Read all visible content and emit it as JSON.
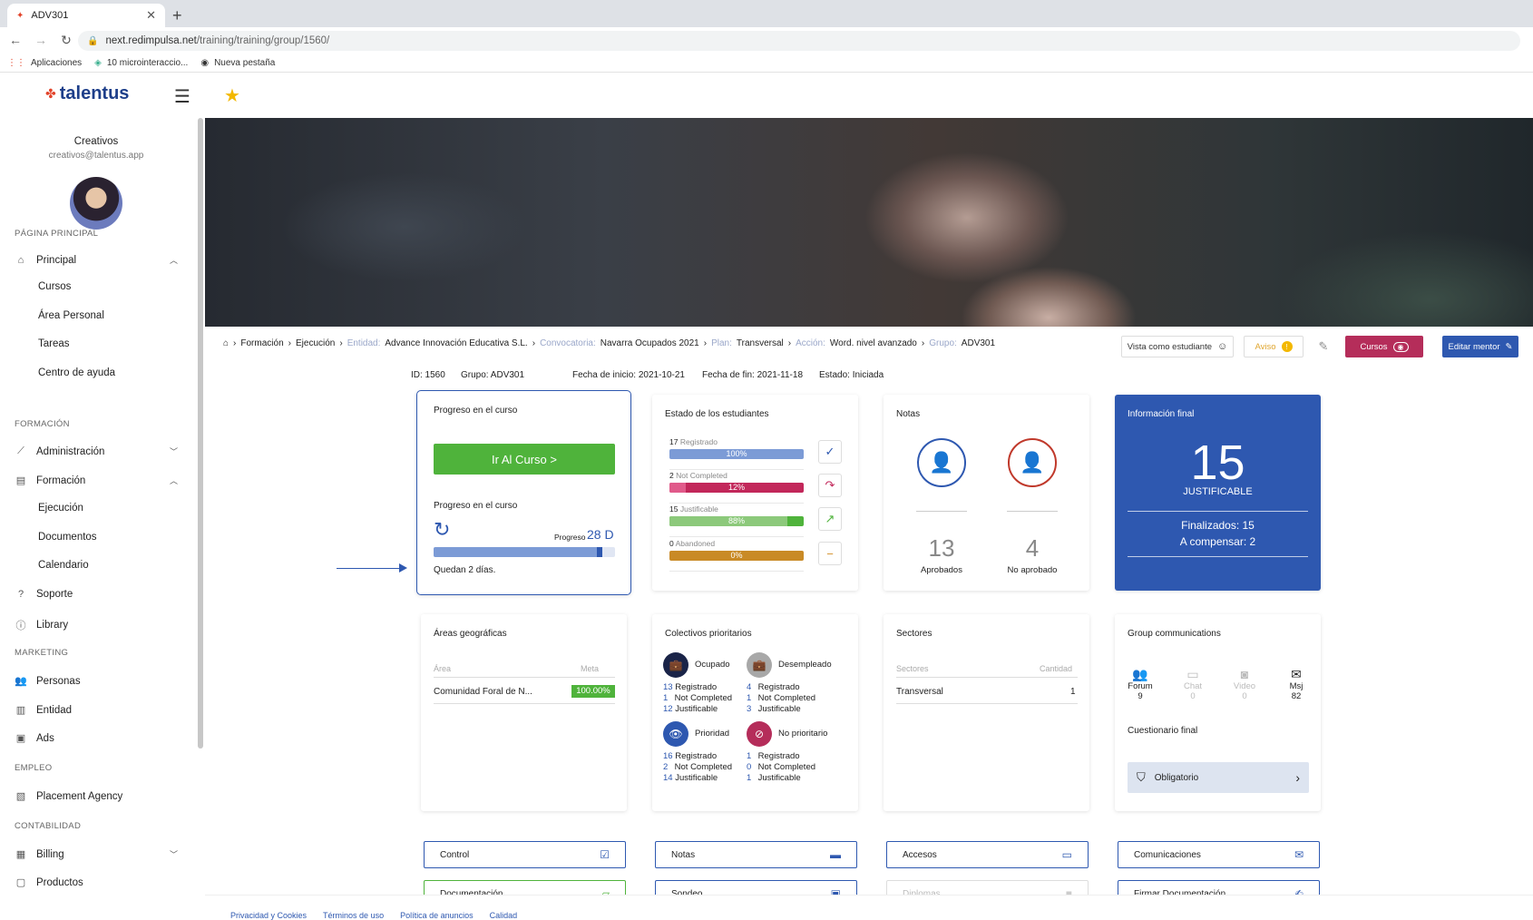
{
  "browser": {
    "tab_title": "ADV301",
    "url_host": "next.redimpulsa.net",
    "url_path": "/training/training/group/1560/",
    "bookmarks": [
      "Aplicaciones",
      "10 microinteraccio...",
      "Nueva pestaña"
    ]
  },
  "sidebar": {
    "logo": "talentus",
    "user_name": "Creativos",
    "user_email": "creativos@talentus.app",
    "sections": {
      "main": "PÁGINA PRINCIPAL",
      "training": "FORMACIÓN",
      "marketing": "MARKETING",
      "employment": "EMPLEO",
      "accounting": "CONTABILIDAD"
    },
    "items": {
      "principal": "Principal",
      "cursos": "Cursos",
      "area_personal": "Área Personal",
      "tareas": "Tareas",
      "centro_ayuda": "Centro de ayuda",
      "administracion": "Administración",
      "formacion": "Formación",
      "ejecucion": "Ejecución",
      "documentos": "Documentos",
      "calendario": "Calendario",
      "soporte": "Soporte",
      "library": "Library",
      "personas": "Personas",
      "entidad": "Entidad",
      "ads": "Ads",
      "placement": "Placement Agency",
      "billing": "Billing",
      "productos": "Productos"
    }
  },
  "breadcrumb": {
    "formacion": "Formación",
    "ejecucion": "Ejecución",
    "entidad_lbl": "Entidad:",
    "entidad": "Advance Innovación Educativa S.L.",
    "convocatoria_lbl": "Convocatoria:",
    "convocatoria": "Navarra Ocupados 2021",
    "plan_lbl": "Plan:",
    "plan": "Transversal",
    "accion_lbl": "Acción:",
    "accion": "Word. nivel avanzado",
    "grupo_lbl": "Grupo:",
    "grupo": "ADV301"
  },
  "actions": {
    "vista": "Vista como estudiante",
    "aviso": "Aviso",
    "cursos": "Cursos",
    "mentor": "Editar mentor"
  },
  "info": {
    "id": "ID: 1560",
    "grupo": "Grupo: ADV301",
    "inicio": "Fecha de inicio: 2021-10-21",
    "fin": "Fecha de fin: 2021-11-18",
    "estado": "Estado: Iniciada"
  },
  "progreso": {
    "title": "Progreso en el curso",
    "button": "Ir Al Curso >",
    "subtitle": "Progreso en el curso",
    "days_label": "Progreso",
    "days": "28 D",
    "remaining": "Quedan 2 días.",
    "fraction": 0.93
  },
  "estado": {
    "title": "Estado de los estudiantes",
    "rows": [
      {
        "count": "17",
        "label": "Registrado",
        "pct": "100%",
        "value": 100,
        "color": "#7c9bd6",
        "track": "#c9d5ef",
        "icon": "✓",
        "icon_color": "#2e58b0"
      },
      {
        "count": "2",
        "label": "Not Completed",
        "pct": "12%",
        "value": 12,
        "color": "#e05a8a",
        "track": "#c2275a",
        "icon": "↷",
        "icon_color": "#c2275a"
      },
      {
        "count": "15",
        "label": "Justificable",
        "pct": "88%",
        "value": 88,
        "color": "#8cc97b",
        "track": "#4fb33b",
        "icon": "↗",
        "icon_color": "#4fb33b"
      },
      {
        "count": "0",
        "label": "Abandoned",
        "pct": "0%",
        "value": 0,
        "color": "#d49a3a",
        "track": "#c98a26",
        "icon": "−",
        "icon_color": "#d4902a"
      }
    ]
  },
  "notas": {
    "title": "Notas",
    "aprobados": "13",
    "aprobados_lbl": "Aprobados",
    "no_aprobado": "4",
    "no_aprobado_lbl": "No aprobado"
  },
  "final": {
    "title": "Información final",
    "number": "15",
    "label": "JUSTIFICABLE",
    "finalizados": "Finalizados:  15",
    "compensar": "A compensar:  2"
  },
  "areas": {
    "title": "Áreas geográficas",
    "col_area": "Área",
    "col_meta": "Meta",
    "row_area": "Comunidad Foral de N...",
    "row_meta": "100.00%"
  },
  "colectivos": {
    "title": "Colectivos prioritarios",
    "groups": [
      {
        "name": "Ocupado",
        "reg": "13",
        "nc": "1",
        "just": "12"
      },
      {
        "name": "Desempleado",
        "reg": "4",
        "nc": "1",
        "just": "3"
      },
      {
        "name": "Prioridad",
        "reg": "16",
        "nc": "2",
        "just": "14"
      },
      {
        "name": "No prioritario",
        "reg": "1",
        "nc": "0",
        "just": "1"
      }
    ],
    "lbl_reg": "Registrado",
    "lbl_nc": "Not Completed",
    "lbl_just": "Justificable"
  },
  "sectores": {
    "title": "Sectores",
    "col_sector": "Sectores",
    "col_cantidad": "Cantidad",
    "row_sector": "Transversal",
    "row_cantidad": "1"
  },
  "comm": {
    "title": "Group communications",
    "forum": "Forum",
    "forum_n": "9",
    "chat": "Chat",
    "chat_n": "0",
    "video": "Video",
    "video_n": "0",
    "msj": "Msj",
    "msj_n": "82",
    "cuestionario": "Cuestionario final",
    "obligatorio": "Obligatorio"
  },
  "bottom": {
    "control": "Control",
    "notas": "Notas",
    "accesos": "Accesos",
    "comunicaciones": "Comunicaciones",
    "documentacion": "Documentación",
    "sondeo": "Sondeo",
    "diplomas": "Diplomas",
    "firmar": "Firmar Documentación"
  },
  "footer": [
    "Privacidad y Cookies",
    "Términos de uso",
    "Política de anuncios",
    "Calidad"
  ]
}
